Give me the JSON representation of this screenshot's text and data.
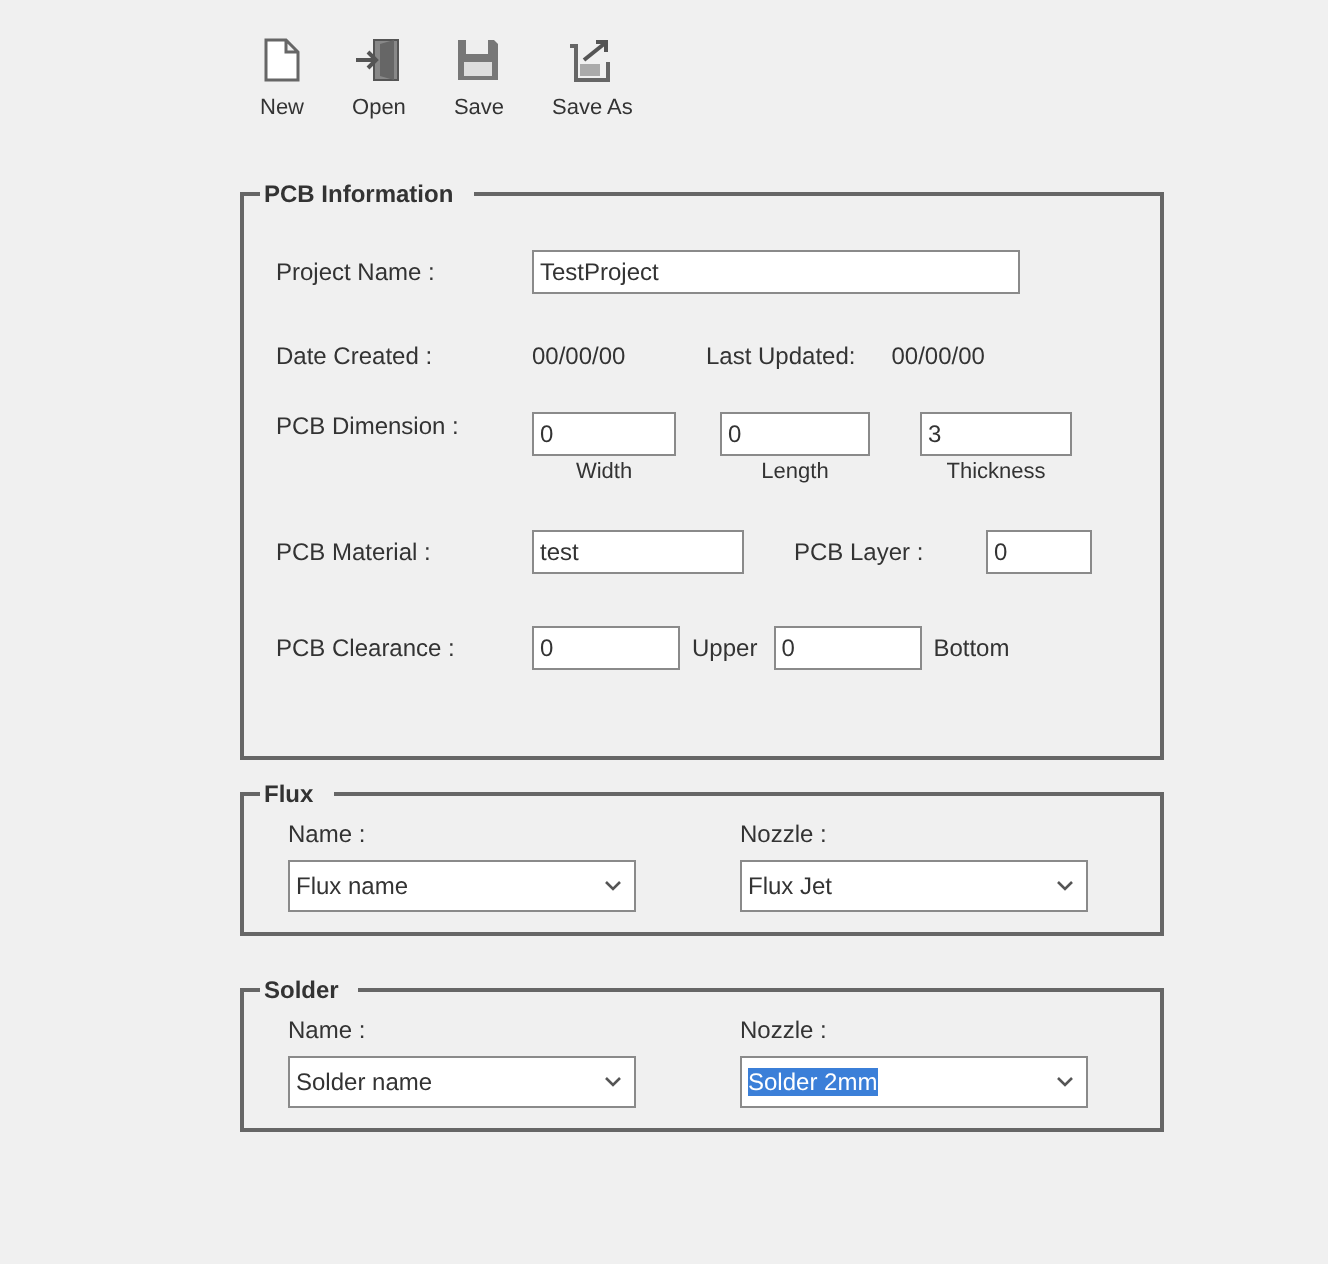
{
  "toolbar": [
    {
      "kind": "new",
      "label": "New"
    },
    {
      "kind": "open",
      "label": "Open"
    },
    {
      "kind": "save",
      "label": "Save"
    },
    {
      "kind": "save_as",
      "label": "Save As"
    }
  ],
  "pcb_information": {
    "title": "PCB Information",
    "project_name": {
      "label": "Project Name :",
      "value": "TestProject"
    },
    "date_created": {
      "label": "Date Created :",
      "value": "00/00/00"
    },
    "last_updated": {
      "label": "Last Updated:",
      "value": "00/00/00"
    },
    "dimension": {
      "label": "PCB Dimension :",
      "fields": [
        {
          "value": "0",
          "caption": "Width"
        },
        {
          "value": "0",
          "caption": "Length"
        },
        {
          "value": "3",
          "caption": "Thickness"
        }
      ]
    },
    "material": {
      "label": "PCB Material :",
      "value": "test"
    },
    "layer": {
      "label": "PCB Layer :",
      "value": "0"
    },
    "clearance": {
      "label": "PCB Clearance :",
      "fields": [
        {
          "value": "0",
          "caption": "Upper"
        },
        {
          "value": "0",
          "caption": "Bottom"
        }
      ]
    }
  },
  "flux": {
    "title": "Flux",
    "name": {
      "label": "Name :",
      "value": "Flux name",
      "text_selected": false
    },
    "nozzle": {
      "label": "Nozzle :",
      "value": "Flux Jet",
      "text_selected": false
    }
  },
  "solder": {
    "title": "Solder",
    "name": {
      "label": "Name :",
      "value": "Solder name",
      "text_selected": false
    },
    "nozzle": {
      "label": "Nozzle :",
      "value": "Solder 2mm",
      "text_selected": true
    }
  }
}
